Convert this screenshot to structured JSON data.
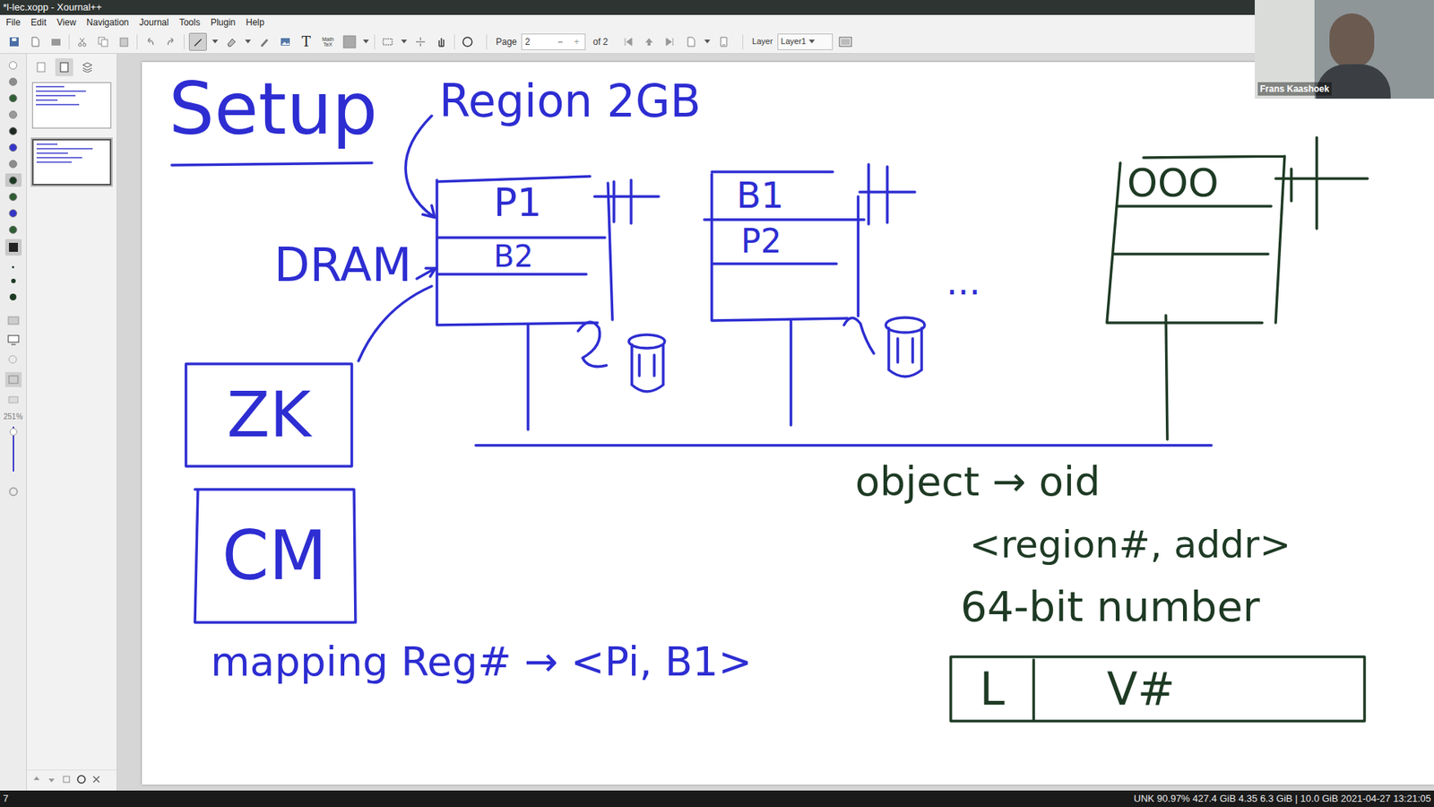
{
  "window": {
    "title": "*l-lec.xopp - Xournal++"
  },
  "menu": [
    "File",
    "Edit",
    "View",
    "Navigation",
    "Journal",
    "Tools",
    "Plugin",
    "Help"
  ],
  "toolbar": {
    "text_tool": "T",
    "math_tex": "Math TeX",
    "pen_selected": true,
    "page_label": "Page",
    "page_value": "2",
    "page_minus": "−",
    "page_plus": "+",
    "page_total": "of 2",
    "layer_label": "Layer",
    "layer_value": "Layer1"
  },
  "palette": [
    {
      "color": "#ffffff",
      "selected": false
    },
    {
      "color": "#8c8c8c",
      "selected": false
    },
    {
      "color": "#2f5d34",
      "selected": false
    },
    {
      "color": "#9a9a9a",
      "selected": false
    },
    {
      "color": "#1f2a22",
      "selected": false
    },
    {
      "color": "#3535c8",
      "selected": false
    },
    {
      "color": "#8c8c8c",
      "selected": false
    },
    {
      "color": "#1e3a24",
      "selected": true
    },
    {
      "color": "#2f5d34",
      "selected": false
    },
    {
      "color": "#3535c8",
      "selected": false
    },
    {
      "color": "#2f5d34",
      "selected": false
    }
  ],
  "sidebar": {
    "zoom": "251%",
    "thumbnails": [
      {
        "selected": false
      },
      {
        "selected": true
      }
    ]
  },
  "canvas": {
    "texts": [
      {
        "text": "Setup",
        "color": "#2d2dd2"
      },
      {
        "text": "Region 2GB",
        "color": "#2d2dd2"
      },
      {
        "text": "DRAM",
        "color": "#2d2dd2"
      },
      {
        "text": "P1",
        "color": "#2d2dd2"
      },
      {
        "text": "B2",
        "color": "#2d2dd2"
      },
      {
        "text": "B1",
        "color": "#2d2dd2"
      },
      {
        "text": "P2",
        "color": "#2d2dd2"
      },
      {
        "text": "...",
        "color": "#2d2dd2"
      },
      {
        "text": "OOO",
        "color": "#1e3a24"
      },
      {
        "text": "ZK",
        "color": "#2d2dd2"
      },
      {
        "text": "CM",
        "color": "#2d2dd2"
      },
      {
        "text": "mapping Reg# → <Pi, B1>",
        "color": "#2d2dd2"
      },
      {
        "text": "object → oid",
        "color": "#1e3a24"
      },
      {
        "text": "<region#, addr>",
        "color": "#1e3a24"
      },
      {
        "text": "64-bit number",
        "color": "#1e3a24"
      },
      {
        "text": "L",
        "color": "#1e3a24"
      },
      {
        "text": "V#",
        "color": "#1e3a24"
      }
    ]
  },
  "video": {
    "name": "Frans Kaashoek"
  },
  "status_bar": {
    "left": "7",
    "right": "UNK 90.97% 427.4 GiB 4.35 6.3 GiB | 10.0 GiB 2021-04-27 13:21:05"
  }
}
